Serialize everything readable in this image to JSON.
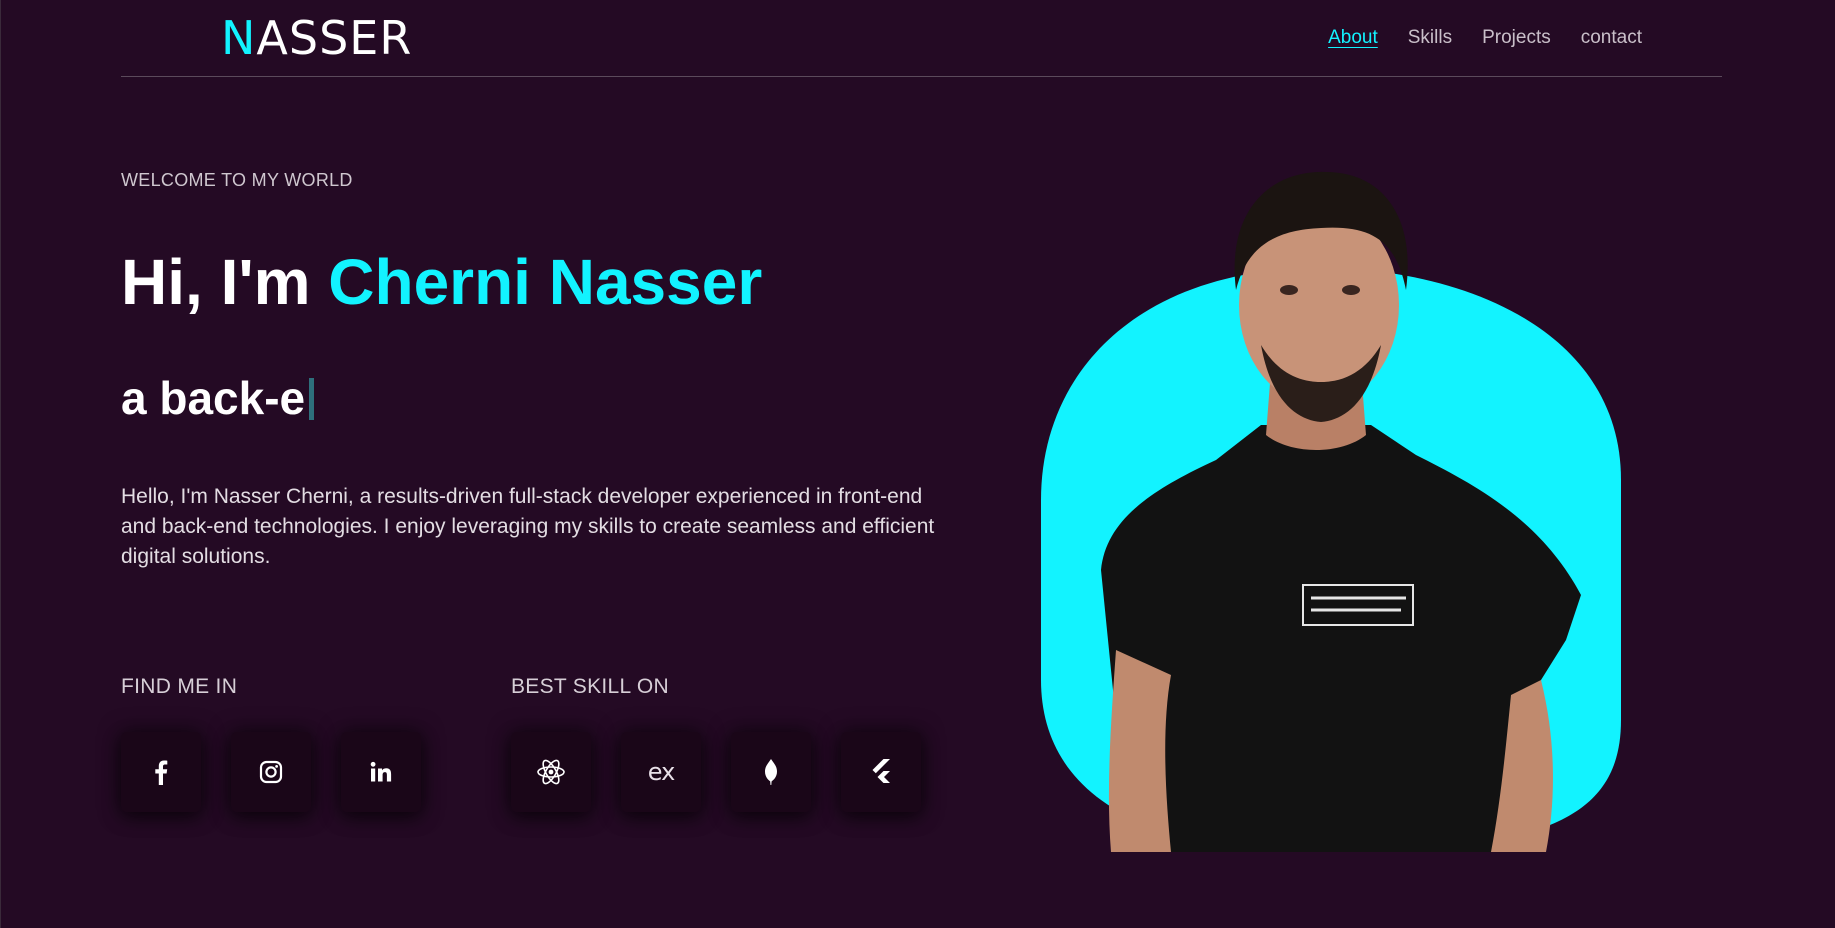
{
  "header": {
    "logo_first": "N",
    "logo_rest": "ASSER",
    "nav": [
      {
        "label": "About",
        "active": true
      },
      {
        "label": "Skills",
        "active": false
      },
      {
        "label": "Projects",
        "active": false
      },
      {
        "label": "contact",
        "active": false
      }
    ]
  },
  "hero": {
    "welcome": "WELCOME TO MY WORLD",
    "greeting_prefix": "Hi, I'm ",
    "greeting_name": "Cherni Nasser",
    "typed_text": "a back-e",
    "intro": "Hello, I'm Nasser Cherni, a results-driven full-stack developer experienced in front-end and back-end technologies. I enjoy leveraging my skills to create seamless and efficient digital solutions."
  },
  "social": {
    "title": "FIND ME IN",
    "items": [
      {
        "icon": "facebook-icon"
      },
      {
        "icon": "instagram-icon"
      },
      {
        "icon": "linkedin-icon"
      }
    ]
  },
  "skills": {
    "title": "BEST SKILL ON",
    "items": [
      {
        "icon": "react-icon"
      },
      {
        "icon": "express-icon",
        "text": "ex"
      },
      {
        "icon": "mongodb-icon"
      },
      {
        "icon": "flutter-icon"
      }
    ]
  },
  "colors": {
    "background": "#240a24",
    "accent": "#12f3ff",
    "button_bg": "#1a0618"
  }
}
